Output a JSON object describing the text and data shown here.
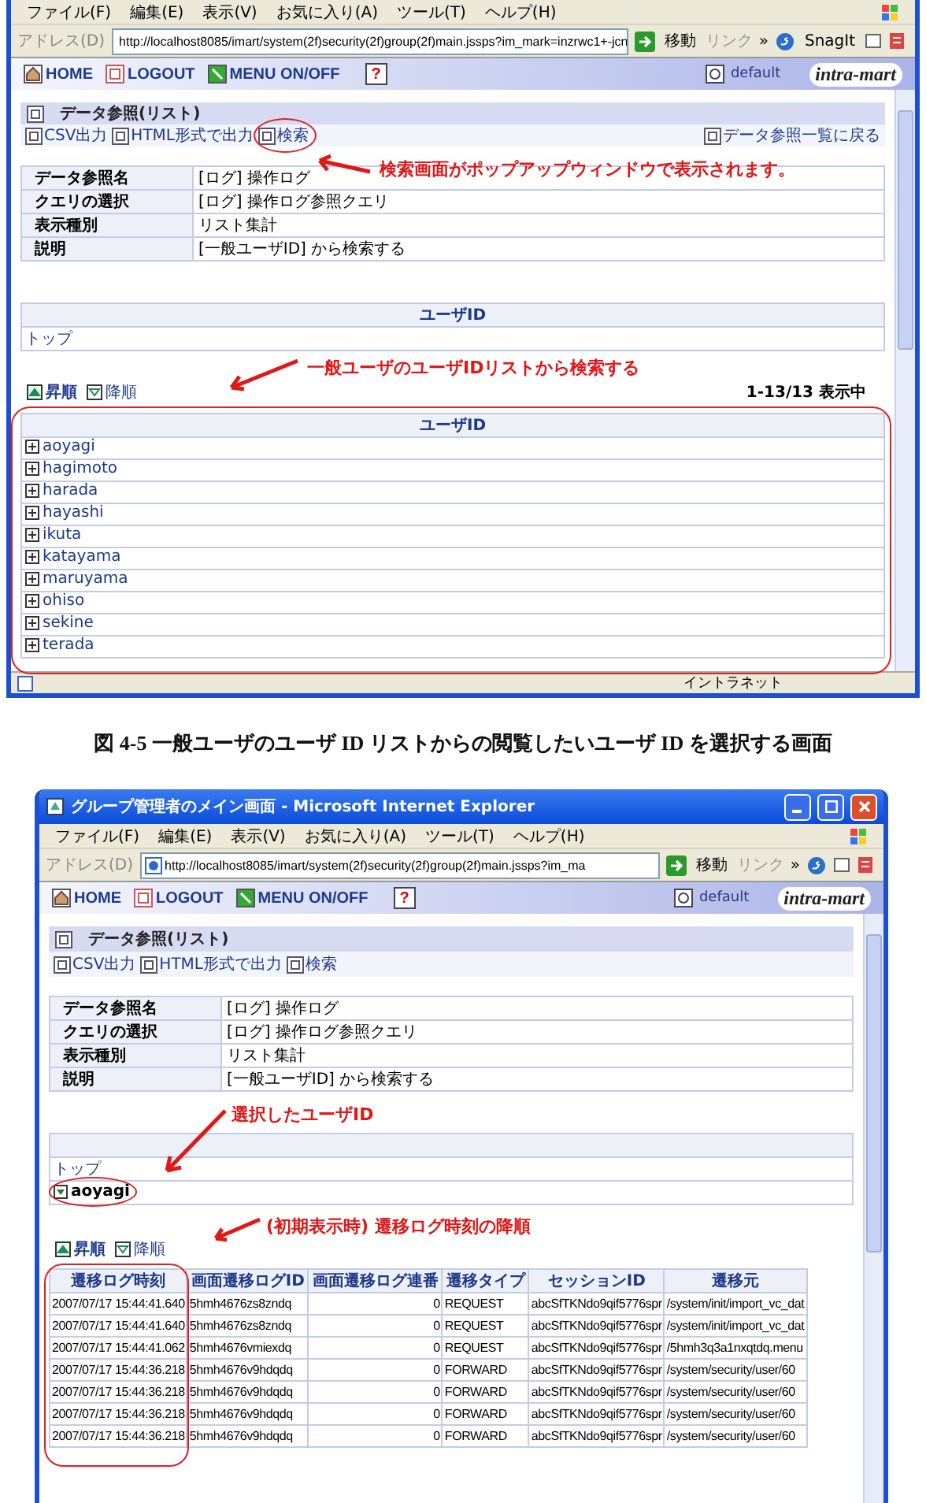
{
  "screenshot_1": {
    "menu": [
      "ファイル(F)",
      "編集(E)",
      "表示(V)",
      "お気に入り(A)",
      "ツール(T)",
      "ヘルプ(H)"
    ],
    "address": {
      "label": "アドレス(D)",
      "url": "http://localhost8085/imart/system(2f)security(2f)group(2f)main.jssps?im_mark=inzrwc1+-jcn",
      "go": "移動",
      "links": "リンク",
      "chevron": "»",
      "snagit": "SnagIt"
    },
    "header": {
      "nav": [
        {
          "kind": "home",
          "label": "HOME"
        },
        {
          "kind": "logout",
          "label": "LOGOUT"
        },
        {
          "kind": "menu",
          "label": "MENU ON/OFF"
        },
        {
          "kind": "help",
          "label": "?"
        }
      ],
      "theme": "default",
      "logo": "intra-mart"
    },
    "panel": {
      "title": "データ参照(リスト)",
      "actions": [
        {
          "label": "CSV出力",
          "highlighted": false
        },
        {
          "label": "HTML形式で出力",
          "highlighted": false
        },
        {
          "label": "検索",
          "highlighted": true
        }
      ],
      "back": "データ参照一覧に戻る"
    },
    "note_1": "検索画面がポップアップウィンドウで表示されます。",
    "info": [
      {
        "label": "データ参照名",
        "value": "[ログ] 操作ログ"
      },
      {
        "label": "クエリの選択",
        "value": "[ログ] 操作ログ参照クエリ"
      },
      {
        "label": "表示種別",
        "value": "リスト集計"
      },
      {
        "label": "説明",
        "value": "[一般ユーザID] から検索する"
      }
    ],
    "tree": {
      "header": "ユーザID",
      "rows": [
        {
          "label": "トップ"
        }
      ]
    },
    "note_2": "一般ユーザのユーザIDリストから検索する",
    "sort": [
      {
        "label": "昇順",
        "selected": true
      },
      {
        "label": "降順",
        "selected": false
      }
    ],
    "count": "1-13/13  表示中",
    "list": {
      "header": "ユーザID",
      "rows": [
        {
          "label": "aoyagi",
          "expanded": false
        },
        {
          "label": "hagimoto",
          "expanded": false
        },
        {
          "label": "harada",
          "expanded": false
        },
        {
          "label": "hayashi",
          "expanded": false
        },
        {
          "label": "ikuta",
          "expanded": false
        },
        {
          "label": "katayama",
          "expanded": false
        },
        {
          "label": "maruyama",
          "expanded": false
        },
        {
          "label": "ohiso",
          "expanded": false
        },
        {
          "label": "sekine",
          "expanded": false
        },
        {
          "label": "terada",
          "expanded": false
        }
      ]
    },
    "status": "イントラネット"
  },
  "caption": "図  4-5  一般ユーザのユーザ ID リストからの閲覧したいユーザ ID を選択する画面",
  "screenshot_2": {
    "title": "グループ管理者のメイン画面 - Microsoft Internet Explorer",
    "menu": [
      "ファイル(F)",
      "編集(E)",
      "表示(V)",
      "お気に入り(A)",
      "ツール(T)",
      "ヘルプ(H)"
    ],
    "address": {
      "label": "アドレス(D)",
      "url": "http://localhost8085/imart/system(2f)security(2f)group(2f)main.jssps?im_ma",
      "go": "移動",
      "links": "リンク",
      "chevron": "»"
    },
    "header": {
      "nav": [
        {
          "kind": "home",
          "label": "HOME"
        },
        {
          "kind": "logout",
          "label": "LOGOUT"
        },
        {
          "kind": "menu",
          "label": "MENU ON/OFF"
        },
        {
          "kind": "help",
          "label": "?"
        }
      ],
      "theme": "default",
      "logo": "intra-mart"
    },
    "panel": {
      "title": "データ参照(リスト)",
      "actions": [
        {
          "label": "CSV出力",
          "highlighted": false
        },
        {
          "label": "HTML形式で出力",
          "highlighted": false
        },
        {
          "label": "検索",
          "highlighted": false
        }
      ]
    },
    "info": [
      {
        "label": "データ参照名",
        "value": "[ログ] 操作ログ"
      },
      {
        "label": "クエリの選択",
        "value": "[ログ] 操作ログ参照クエリ"
      },
      {
        "label": "表示種別",
        "value": "リスト集計"
      },
      {
        "label": "説明",
        "value": "[一般ユーザID] から検索する"
      }
    ],
    "note_1": "選択したユーザID",
    "tree": {
      "rows": [
        {
          "label": "トップ",
          "expanded": false,
          "highlighted": false
        },
        {
          "label": "aoyagi",
          "expanded": true,
          "highlighted": true
        }
      ]
    },
    "note_2": "(初期表示時) 遷移ログ時刻の降順",
    "sort": [
      {
        "label": "昇順",
        "selected": true
      },
      {
        "label": "降順",
        "selected": false
      }
    ],
    "table": {
      "columns": [
        "遷移ログ時刻",
        "画面遷移ログID",
        "画面遷移ログ連番",
        "遷移タイプ",
        "セッションID",
        "遷移元"
      ],
      "rows": [
        [
          "2007/07/17 15:44:41.640",
          "5hmh4676zs8zndq",
          "0",
          "REQUEST",
          "abcSfTKNdo9qif5776spr",
          "/system/init/import_vc_dat"
        ],
        [
          "2007/07/17 15:44:41.640",
          "5hmh4676zs8zndq",
          "0",
          "REQUEST",
          "abcSfTKNdo9qif5776spr",
          "/system/init/import_vc_dat"
        ],
        [
          "2007/07/17 15:44:41.062",
          "5hmh4676vmiexdq",
          "0",
          "REQUEST",
          "abcSfTKNdo9qif5776spr",
          "/5hmh3q3a1nxqtdq.menu"
        ],
        [
          "2007/07/17 15:44:36.218",
          "5hmh4676v9hdqdq",
          "0",
          "FORWARD",
          "abcSfTKNdo9qif5776spr",
          "/system/security/user/60"
        ],
        [
          "2007/07/17 15:44:36.218",
          "5hmh4676v9hdqdq",
          "0",
          "FORWARD",
          "abcSfTKNdo9qif5776spr",
          "/system/security/user/60"
        ],
        [
          "2007/07/17 15:44:36.218",
          "5hmh4676v9hdqdq",
          "0",
          "FORWARD",
          "abcSfTKNdo9qif5776spr",
          "/system/security/user/60"
        ],
        [
          "2007/07/17 15:44:36.218",
          "5hmh4676v9hdqdq",
          "0",
          "FORWARD",
          "abcSfTKNdo9qif5776spr",
          "/system/security/user/60"
        ]
      ]
    }
  }
}
